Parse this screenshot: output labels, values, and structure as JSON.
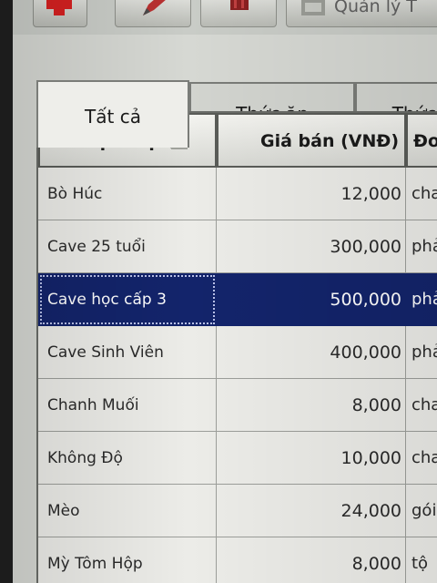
{
  "toolbar": {
    "manage_label": "Quản lý T"
  },
  "tabs": [
    {
      "label": "Tất cả"
    },
    {
      "label": "Thức ăn"
    },
    {
      "label": "Thức"
    }
  ],
  "table": {
    "columns": [
      "Tên dịch vụ",
      "Giá bán (VNĐ)",
      "Đơ"
    ],
    "rows": [
      {
        "name": "Bò Húc",
        "price": "12,000",
        "unit": "cha"
      },
      {
        "name": "Cave 25 tuổi",
        "price": "300,000",
        "unit": "phả"
      },
      {
        "name": "Cave học cấp 3",
        "price": "500,000",
        "unit": "phả"
      },
      {
        "name": "Cave Sinh Viên",
        "price": "400,000",
        "unit": "phả"
      },
      {
        "name": "Chanh Muối",
        "price": "8,000",
        "unit": "cha"
      },
      {
        "name": "Không Độ",
        "price": "10,000",
        "unit": "cha"
      },
      {
        "name": "Mèo",
        "price": "24,000",
        "unit": "gói"
      },
      {
        "name": "Mỳ Tôm Hộp",
        "price": "8,000",
        "unit": "tộ"
      }
    ],
    "selected_row": 2
  },
  "colors": {
    "selection": "#13246b",
    "add_icon": "#d42020"
  }
}
